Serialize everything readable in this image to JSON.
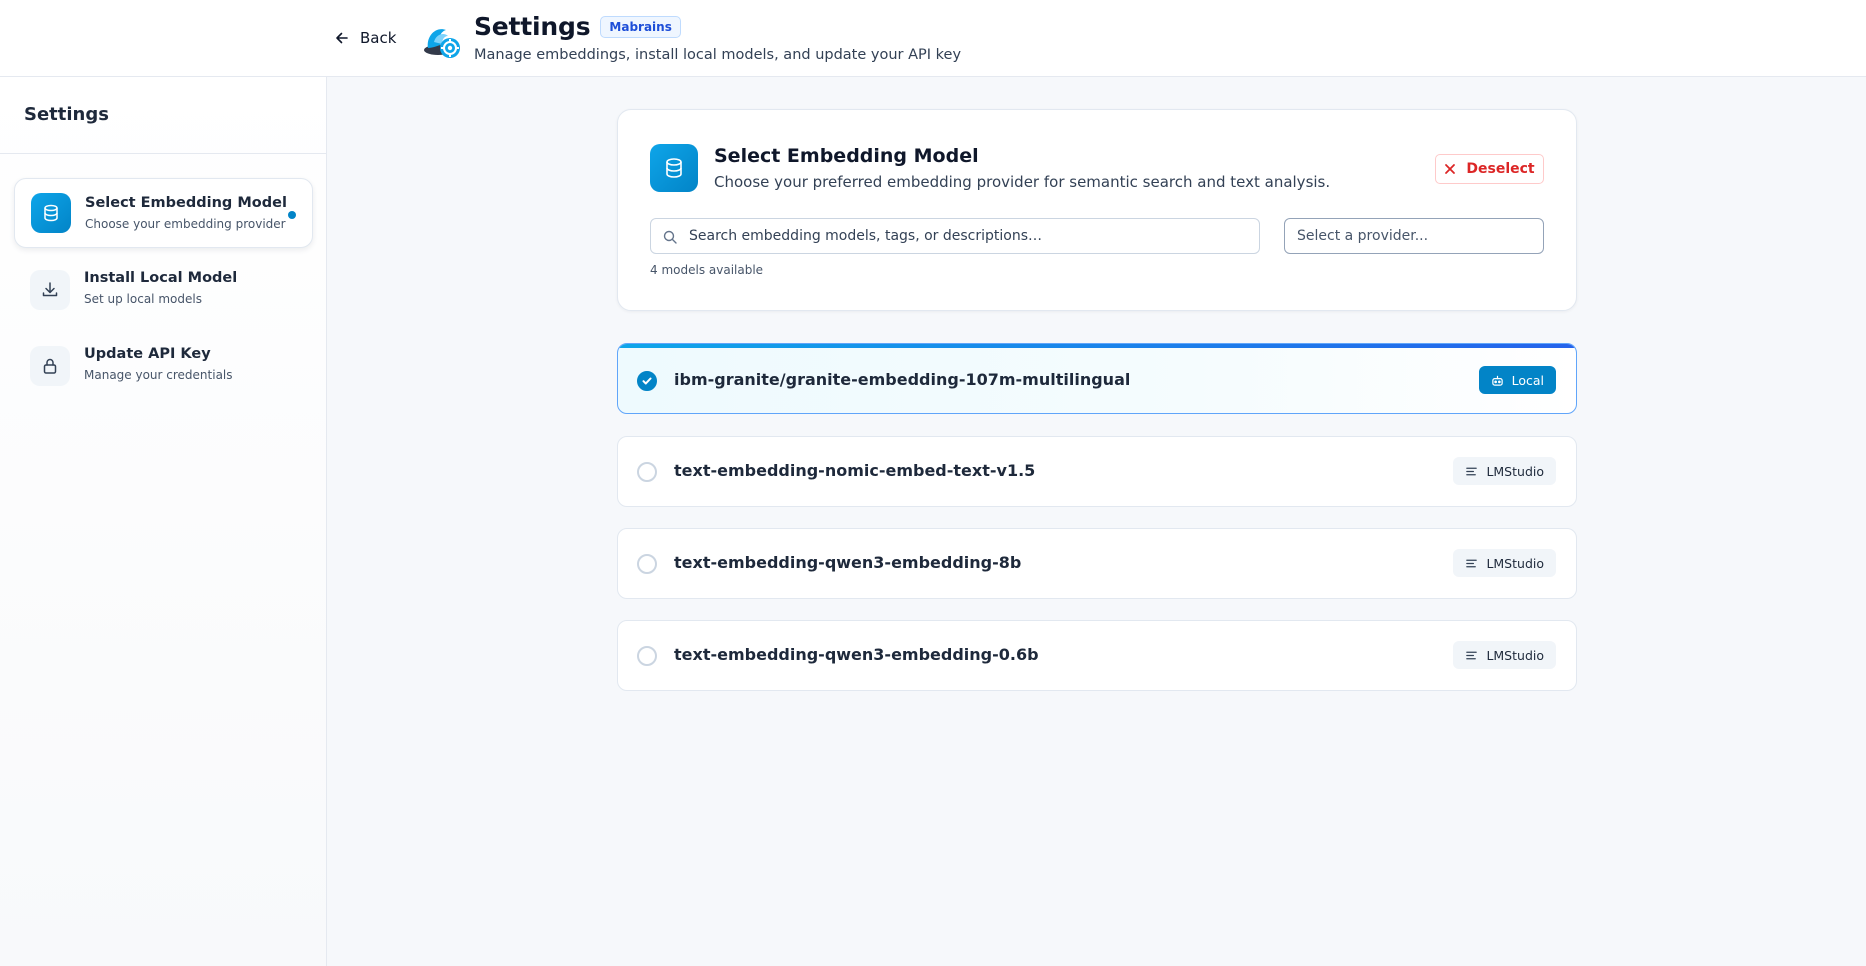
{
  "header": {
    "back_label": "Back",
    "title": "Settings",
    "brand_badge": "Mabrains",
    "subtitle": "Manage embeddings, install local models, and update your API key"
  },
  "sidebar": {
    "title": "Settings",
    "items": [
      {
        "label": "Select Embedding Model",
        "desc": "Choose your embedding provider",
        "icon": "database-icon",
        "active": true
      },
      {
        "label": "Install Local Model",
        "desc": "Set up local models",
        "icon": "download-icon",
        "active": false
      },
      {
        "label": "Update API Key",
        "desc": "Manage your credentials",
        "icon": "lock-icon",
        "active": false
      }
    ]
  },
  "main": {
    "card_title": "Select Embedding Model",
    "card_desc": "Choose your preferred embedding provider for semantic search and text analysis.",
    "deselect_label": "Deselect",
    "search_placeholder": "Search embedding models, tags, or descriptions…",
    "provider_placeholder": "Select a provider...",
    "models_count": "4 models available",
    "models": [
      {
        "name": "ibm-granite/granite-embedding-107m-multilingual",
        "tag": "Local",
        "selected": true
      },
      {
        "name": "text-embedding-nomic-embed-text-v1.5",
        "tag": "LMStudio",
        "selected": false
      },
      {
        "name": "text-embedding-qwen3-embedding-8b",
        "tag": "LMStudio",
        "selected": false
      },
      {
        "name": "text-embedding-qwen3-embedding-0.6b",
        "tag": "LMStudio",
        "selected": false
      }
    ]
  },
  "colors": {
    "accent": "#0284c7",
    "danger": "#dc2626",
    "background": "#f6f8fb"
  }
}
